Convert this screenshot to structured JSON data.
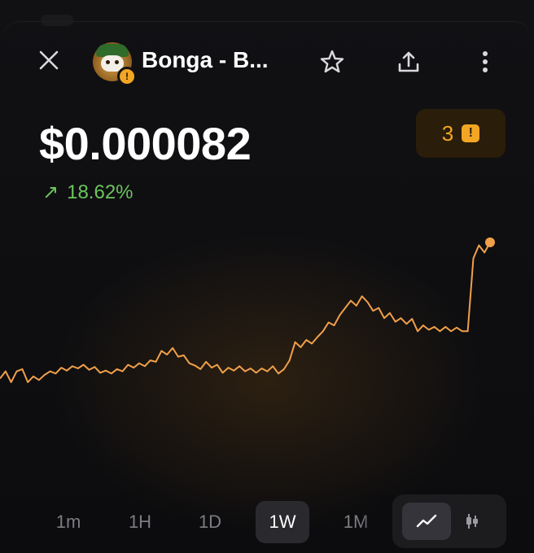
{
  "header": {
    "token_name": "Bonga - B...",
    "icons": {
      "close": "close-icon",
      "avatar": "token-avatar",
      "warning_badge": "warning-badge-icon",
      "favorite": "star-icon",
      "share": "share-icon",
      "more": "more-vertical-icon"
    },
    "warning_glyph": "!"
  },
  "price": {
    "value": "$0.000082",
    "change_arrow": "↗",
    "change_percent": "18.62%",
    "change_color": "#6cc45c"
  },
  "alerts": {
    "count": "3",
    "glyph": "!",
    "accent": "#f3a623"
  },
  "chart_data": {
    "type": "line",
    "color": "#f0a04a",
    "values": [
      5.95e-05,
      6.05e-05,
      5.9e-05,
      6.05e-05,
      6.08e-05,
      5.9e-05,
      5.98e-05,
      5.93e-05,
      6e-05,
      6.05e-05,
      6.02e-05,
      6.1e-05,
      6.06e-05,
      6.12e-05,
      6.09e-05,
      6.14e-05,
      6.07e-05,
      6.11e-05,
      6.03e-05,
      6.06e-05,
      6.02e-05,
      6.08e-05,
      6.05e-05,
      6.14e-05,
      6.1e-05,
      6.16e-05,
      6.12e-05,
      6.2e-05,
      6.18e-05,
      6.33e-05,
      6.28e-05,
      6.37e-05,
      6.25e-05,
      6.27e-05,
      6.16e-05,
      6.13e-05,
      6.08e-05,
      6.18e-05,
      6.1e-05,
      6.14e-05,
      6.03e-05,
      6.1e-05,
      6.06e-05,
      6.12e-05,
      6.05e-05,
      6.09e-05,
      6.03e-05,
      6.09e-05,
      6.05e-05,
      6.12e-05,
      6.02e-05,
      6.08e-05,
      6.2e-05,
      6.45e-05,
      6.38e-05,
      6.48e-05,
      6.43e-05,
      6.52e-05,
      6.6e-05,
      6.72e-05,
      6.68e-05,
      6.82e-05,
      6.92e-05,
      7.02e-05,
      6.95e-05,
      7.08e-05,
      7e-05,
      6.88e-05,
      6.92e-05,
      6.78e-05,
      6.85e-05,
      6.73e-05,
      6.78e-05,
      6.7e-05,
      6.77e-05,
      6.6e-05,
      6.68e-05,
      6.62e-05,
      6.66e-05,
      6.6e-05,
      6.66e-05,
      6.6e-05,
      6.65e-05,
      6.6e-05,
      6.6e-05,
      7.6e-05,
      7.78e-05,
      7.68e-05,
      7.82e-05
    ],
    "end_marker": true
  },
  "ranges": {
    "items": [
      "1m",
      "1H",
      "1D",
      "1W",
      "1M"
    ],
    "active": "1W"
  },
  "chart_mode": {
    "line_icon": "line-chart-icon",
    "candle_icon": "candlestick-icon",
    "active": "line"
  }
}
